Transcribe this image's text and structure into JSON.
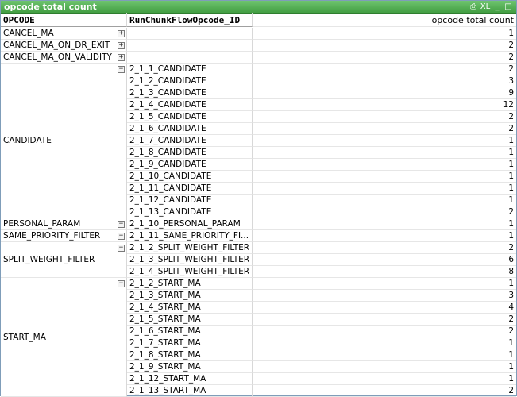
{
  "window": {
    "title": "opcode total count",
    "btn_xl": "XL",
    "btn_min": "_",
    "btn_max": "□"
  },
  "headers": {
    "col1": "OPCODE",
    "col2": "RunChunkFlowOpcode_ID",
    "col3": "opcode total count"
  },
  "groups": [
    {
      "opcode": "CANCEL_MA",
      "toggle": "+",
      "rows": [
        {
          "id": "",
          "count": "1"
        }
      ]
    },
    {
      "opcode": "CANCEL_MA_ON_DR_EXIT",
      "toggle": "+",
      "rows": [
        {
          "id": "",
          "count": "2"
        }
      ]
    },
    {
      "opcode": "CANCEL_MA_ON_VALIDITY",
      "toggle": "+",
      "rows": [
        {
          "id": "",
          "count": "2"
        }
      ]
    },
    {
      "opcode": "CANDIDATE",
      "toggle": "−",
      "rows": [
        {
          "id": "2_1_1_CANDIDATE",
          "count": "2"
        },
        {
          "id": "2_1_2_CANDIDATE",
          "count": "3"
        },
        {
          "id": "2_1_3_CANDIDATE",
          "count": "9"
        },
        {
          "id": "2_1_4_CANDIDATE",
          "count": "12"
        },
        {
          "id": "2_1_5_CANDIDATE",
          "count": "2"
        },
        {
          "id": "2_1_6_CANDIDATE",
          "count": "2"
        },
        {
          "id": "2_1_7_CANDIDATE",
          "count": "1"
        },
        {
          "id": "2_1_8_CANDIDATE",
          "count": "1"
        },
        {
          "id": "2_1_9_CANDIDATE",
          "count": "1"
        },
        {
          "id": "2_1_10_CANDIDATE",
          "count": "1"
        },
        {
          "id": "2_1_11_CANDIDATE",
          "count": "1"
        },
        {
          "id": "2_1_12_CANDIDATE",
          "count": "1"
        },
        {
          "id": "2_1_13_CANDIDATE",
          "count": "2"
        }
      ]
    },
    {
      "opcode": "PERSONAL_PARAM",
      "toggle": "−",
      "rows": [
        {
          "id": "2_1_10_PERSONAL_PARAM",
          "count": "1"
        }
      ]
    },
    {
      "opcode": "SAME_PRIORITY_FILTER",
      "toggle": "−",
      "rows": [
        {
          "id": "2_1_11_SAME_PRIORITY_FI...",
          "count": "1"
        }
      ]
    },
    {
      "opcode": "SPLIT_WEIGHT_FILTER",
      "toggle": "−",
      "rows": [
        {
          "id": "2_1_2_SPLIT_WEIGHT_FILTER",
          "count": "2"
        },
        {
          "id": "2_1_3_SPLIT_WEIGHT_FILTER",
          "count": "6"
        },
        {
          "id": "2_1_4_SPLIT_WEIGHT_FILTER",
          "count": "8"
        }
      ]
    },
    {
      "opcode": "START_MA",
      "toggle": "−",
      "rows": [
        {
          "id": "2_1_2_START_MA",
          "count": "1"
        },
        {
          "id": "2_1_3_START_MA",
          "count": "3"
        },
        {
          "id": "2_1_4_START_MA",
          "count": "4"
        },
        {
          "id": "2_1_5_START_MA",
          "count": "2"
        },
        {
          "id": "2_1_6_START_MA",
          "count": "2"
        },
        {
          "id": "2_1_7_START_MA",
          "count": "1"
        },
        {
          "id": "2_1_8_START_MA",
          "count": "1"
        },
        {
          "id": "2_1_9_START_MA",
          "count": "1"
        },
        {
          "id": "2_1_12_START_MA",
          "count": "1"
        },
        {
          "id": "2_1_13_START_MA",
          "count": "2"
        }
      ]
    }
  ]
}
